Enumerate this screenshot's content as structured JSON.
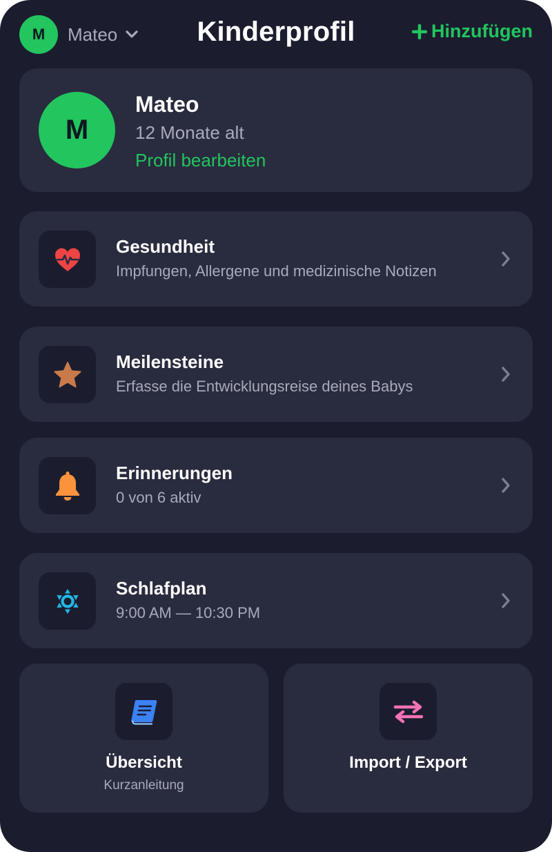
{
  "header": {
    "current_profile_initial": "M",
    "current_profile_name": "Mateo",
    "title": "Kinderprofil",
    "add_label": "Hinzufügen"
  },
  "profile": {
    "initial": "M",
    "name": "Mateo",
    "age": "12 Monate alt",
    "edit_label": "Profil bearbeiten"
  },
  "sections": [
    {
      "title": "Gesundheit",
      "subtitle": "Impfungen, Allergene und medizinische Notizen",
      "icon": "heart-pulse-icon"
    },
    {
      "title": "Meilensteine",
      "subtitle": "Erfasse die Entwicklungsreise deines Babys",
      "icon": "star-icon"
    },
    {
      "title": "Erinnerungen",
      "subtitle": "0 von 6 aktiv",
      "icon": "bell-icon"
    },
    {
      "title": "Schlafplan",
      "subtitle": "9:00 AM — 10:30 PM",
      "icon": "sun-icon"
    }
  ],
  "tiles": [
    {
      "title": "Übersicht",
      "subtitle": "Kurzanleitung",
      "icon": "book-icon"
    },
    {
      "title": "Import / Export",
      "icon": "swap-arrows-icon"
    }
  ],
  "colors": {
    "background": "#1b1d2f",
    "card": "#292b3e",
    "accent": "#22c55e",
    "secondary_text": "#a8abbb",
    "heart": "#ef4444",
    "star": "#c97a4a",
    "bell": "#fb923c",
    "sun": "#22b8e6",
    "book": "#3b82f6",
    "swap": "#f472b6"
  }
}
